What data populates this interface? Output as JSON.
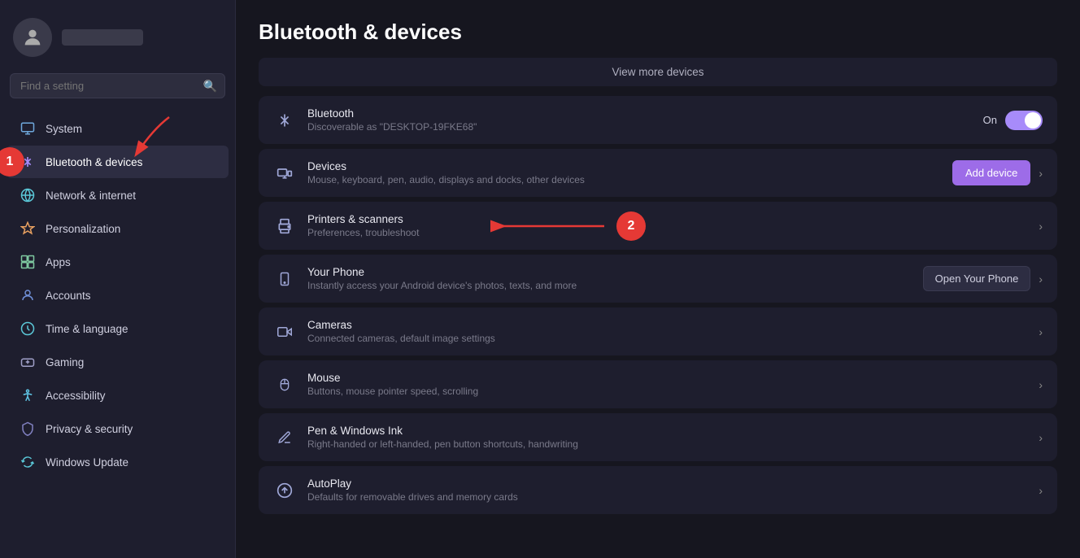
{
  "sidebar": {
    "username": "",
    "search_placeholder": "Find a setting",
    "nav_items": [
      {
        "id": "system",
        "label": "System",
        "icon": "🖥️",
        "active": false
      },
      {
        "id": "bluetooth",
        "label": "Bluetooth & devices",
        "icon": "🔷",
        "active": true
      },
      {
        "id": "network",
        "label": "Network & internet",
        "icon": "🌐",
        "active": false
      },
      {
        "id": "personalization",
        "label": "Personalization",
        "icon": "🖊️",
        "active": false
      },
      {
        "id": "apps",
        "label": "Apps",
        "icon": "📦",
        "active": false
      },
      {
        "id": "accounts",
        "label": "Accounts",
        "icon": "👤",
        "active": false
      },
      {
        "id": "time",
        "label": "Time & language",
        "icon": "🌍",
        "active": false
      },
      {
        "id": "gaming",
        "label": "Gaming",
        "icon": "🎮",
        "active": false
      },
      {
        "id": "accessibility",
        "label": "Accessibility",
        "icon": "♿",
        "active": false
      },
      {
        "id": "privacy",
        "label": "Privacy & security",
        "icon": "🛡️",
        "active": false
      },
      {
        "id": "windows-update",
        "label": "Windows Update",
        "icon": "🔄",
        "active": false
      }
    ]
  },
  "main": {
    "title": "Bluetooth & devices",
    "view_more": "View more devices",
    "rows": [
      {
        "id": "bluetooth",
        "icon": "bt",
        "title": "Bluetooth",
        "subtitle": "Discoverable as \"DESKTOP-19FKE68\"",
        "type": "toggle",
        "toggle_on": true,
        "toggle_label": "On"
      },
      {
        "id": "devices",
        "icon": "devices",
        "title": "Devices",
        "subtitle": "Mouse, keyboard, pen, audio, displays and docks, other devices",
        "type": "button",
        "button_label": "Add device"
      },
      {
        "id": "printers",
        "icon": "printer",
        "title": "Printers & scanners",
        "subtitle": "Preferences, troubleshoot",
        "type": "chevron"
      },
      {
        "id": "phone",
        "icon": "phone",
        "title": "Your Phone",
        "subtitle": "Instantly access your Android device's photos, texts, and more",
        "type": "button",
        "button_label": "Open Your Phone"
      },
      {
        "id": "cameras",
        "icon": "camera",
        "title": "Cameras",
        "subtitle": "Connected cameras, default image settings",
        "type": "chevron"
      },
      {
        "id": "mouse",
        "icon": "mouse",
        "title": "Mouse",
        "subtitle": "Buttons, mouse pointer speed, scrolling",
        "type": "chevron"
      },
      {
        "id": "pen",
        "icon": "pen",
        "title": "Pen & Windows Ink",
        "subtitle": "Right-handed or left-handed, pen button shortcuts, handwriting",
        "type": "chevron"
      },
      {
        "id": "autoplay",
        "icon": "autoplay",
        "title": "AutoPlay",
        "subtitle": "Defaults for removable drives and memory cards",
        "type": "chevron"
      }
    ],
    "annotations": [
      {
        "number": "1",
        "description": "Bluetooth & devices nav item"
      },
      {
        "number": "2",
        "description": "Printers & scanners row"
      }
    ]
  }
}
